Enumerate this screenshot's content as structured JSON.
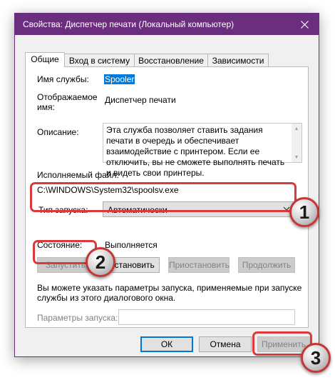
{
  "window": {
    "title": "Свойства: Диспетчер печати (Локальный компьютер)"
  },
  "tabs": [
    {
      "label": "Общие",
      "active": true
    },
    {
      "label": "Вход в систему",
      "active": false
    },
    {
      "label": "Восстановление",
      "active": false
    },
    {
      "label": "Зависимости",
      "active": false
    }
  ],
  "general": {
    "service_name_label": "Имя службы:",
    "service_name_value": "Spooler",
    "display_name_label_1": "Отображаемое",
    "display_name_label_2": "имя:",
    "display_name_value": "Диспетчер печати",
    "description_label": "Описание:",
    "description_text": "Эта служба позволяет ставить задания печати в очередь и обеспечивает взаимодействие с принтером. Если ее отключить, вы не сможете выполнять печать и видеть свои принтеры.",
    "exec_label": "Исполняемый файл:",
    "exec_value": "C:\\WINDOWS\\System32\\spoolsv.exe",
    "startup_type_label": "Тип запуска:",
    "startup_type_value": "Автоматически",
    "status_label": "Состояние:",
    "status_value": "Выполняется",
    "start_button": "Запустить",
    "stop_button": "Остановить",
    "pause_button": "Приостановить",
    "resume_button": "Продолжить",
    "hint_text_1": "Вы можете указать параметры запуска, применяемые при запуске",
    "hint_text_2": "службы из этого диалогового окна.",
    "params_label": "Параметры запуска:",
    "params_value": ""
  },
  "footer": {
    "ok_button": "ОК",
    "cancel_button": "Отмена",
    "apply_button": "Применить"
  },
  "annotations": [
    "1",
    "2",
    "3"
  ],
  "colors": {
    "titlebar": "#6b2e7e",
    "highlight": "#d93b3b",
    "selection": "#0078d7"
  }
}
